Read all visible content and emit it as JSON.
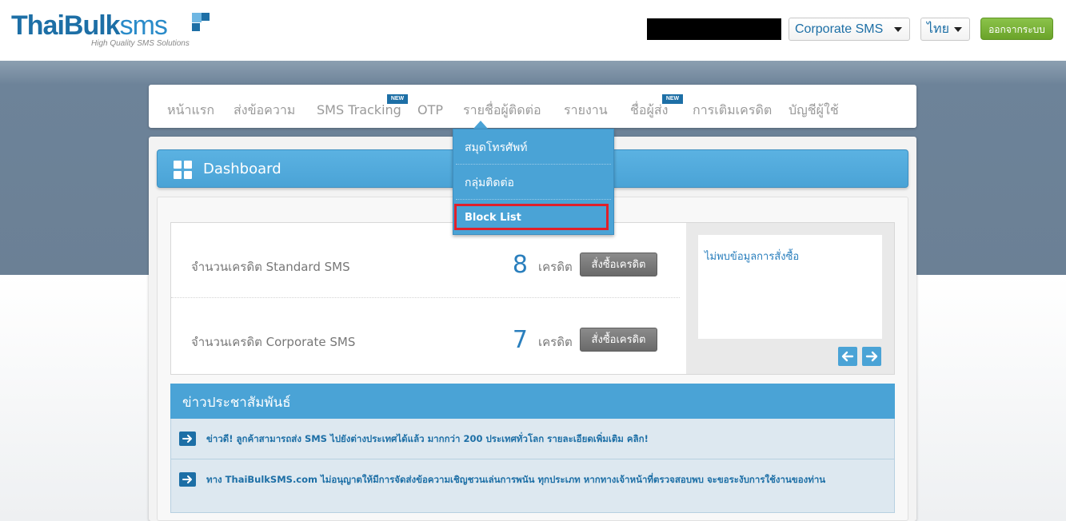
{
  "header": {
    "logo": {
      "part1": "ThaiBulk",
      "part2": "sms",
      "tagline": "High Quality SMS Solutions"
    },
    "sms_type_select": "Corporate SMS",
    "language_select": "ไทย",
    "logout_label": "ออกจากระบบ"
  },
  "nav": {
    "items": [
      {
        "label": "หน้าแรก"
      },
      {
        "label": "ส่งข้อความ"
      },
      {
        "label": "SMS Tracking",
        "badge": "NEW"
      },
      {
        "label": "OTP"
      },
      {
        "label": "รายชื่อผู้ติดต่อ"
      },
      {
        "label": "รายงาน"
      },
      {
        "label": "ชื่อผู้ส่ง",
        "badge": "NEW"
      },
      {
        "label": "การเติมเครดิต"
      },
      {
        "label": "บัญชีผู้ใช้"
      }
    ],
    "dropdown": {
      "items": [
        {
          "label": "สมุดโทรศัพท์"
        },
        {
          "label": "กลุ่มติดต่อ"
        },
        {
          "label": "Block List"
        }
      ]
    }
  },
  "dashboard": {
    "title": "Dashboard",
    "credits": [
      {
        "label": "จำนวนเครดิต Standard SMS",
        "value": "8",
        "unit": "เครดิต",
        "buy_label": "สั่งซื้อเครดิต"
      },
      {
        "label": "จำนวนเครดิต Corporate SMS",
        "value": "7",
        "unit": "เครดิต",
        "buy_label": "สั่งซื้อเครดิต"
      }
    ],
    "orders_empty_text": "ไม่พบข้อมูลการสั่งซื้อ"
  },
  "news": {
    "title": "ข่าวประชาสัมพันธ์",
    "items": [
      {
        "text": "ข่าวดี! ลูกค้าสามารถส่ง SMS ไปยังต่างประเทศได้แล้ว มากกว่า 200 ประเทศทั่วโลก รายละเอียดเพิ่มเติม คลิก!"
      },
      {
        "text": "ทาง ThaiBulkSMS.com ไม่อนุญาตให้มีการจัดส่งข้อความเชิญชวนเล่นการพนัน ทุกประเภท หากทางเจ้าหน้าที่ตรวจสอบพบ จะขอระงับการใช้งานของท่าน"
      }
    ]
  },
  "colors": {
    "brand_blue": "#1d6fa6",
    "accent_blue": "#4aa3d6",
    "logout_green": "#7ab33a",
    "highlight_red": "#e0202a"
  }
}
